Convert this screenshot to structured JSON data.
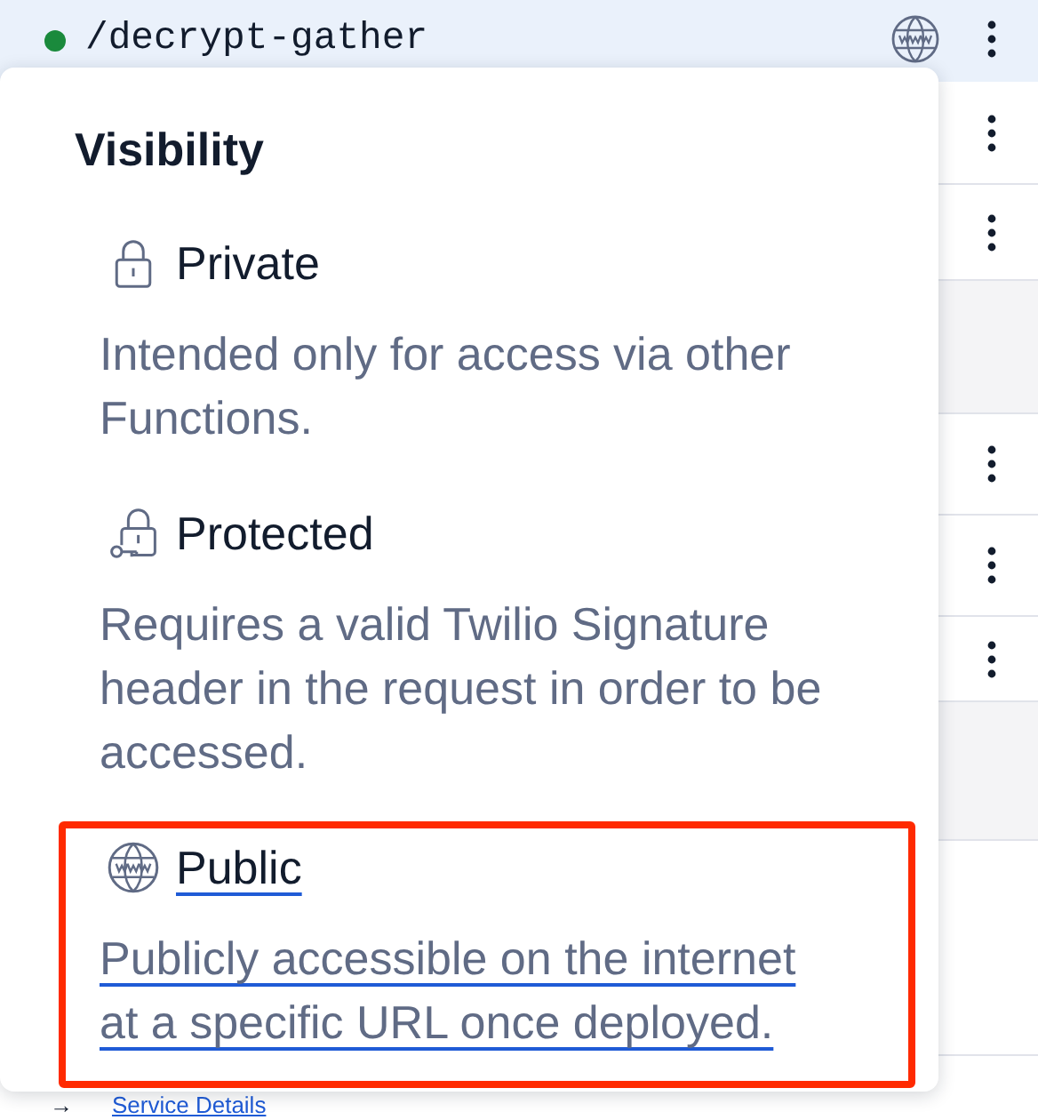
{
  "route": {
    "path": "/decrypt-gather"
  },
  "visibility_menu": {
    "title": "Visibility",
    "options": [
      {
        "kind": "private",
        "label": "Private",
        "description": "Intended only for access via other Functions.",
        "selected": false
      },
      {
        "kind": "protected",
        "label": "Protected",
        "description": "Requires a valid Twilio Signature header in the request in order to be accessed.",
        "selected": false
      },
      {
        "kind": "public",
        "label": "Public",
        "description": "Publicly accessible on the internet at a specific URL once deployed.",
        "selected": true
      }
    ]
  },
  "footer_link": {
    "arrow": "→",
    "label": "Service Details"
  }
}
